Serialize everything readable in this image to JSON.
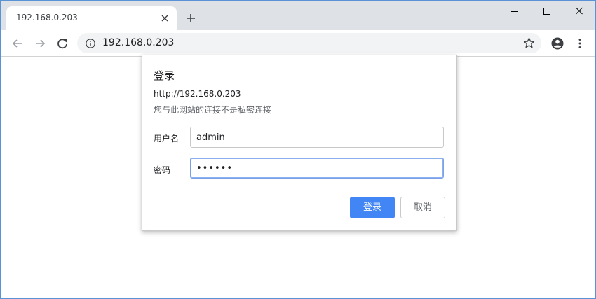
{
  "tab": {
    "title": "192.168.0.203",
    "close_icon": "close-icon"
  },
  "toolbar": {
    "url": "192.168.0.203"
  },
  "dialog": {
    "title": "登录",
    "origin": "http://192.168.0.203",
    "warning": "您与此网站的连接不是私密连接",
    "username_label": "用户名",
    "username_value": "admin",
    "password_label": "密码",
    "password_value": "••••••",
    "login_label": "登录",
    "cancel_label": "取消"
  },
  "colors": {
    "titlebar_bg": "#dee1e6",
    "accent": "#4285f4",
    "omnibox_bg": "#f1f3f4",
    "focus_border": "#7aa0e8"
  }
}
